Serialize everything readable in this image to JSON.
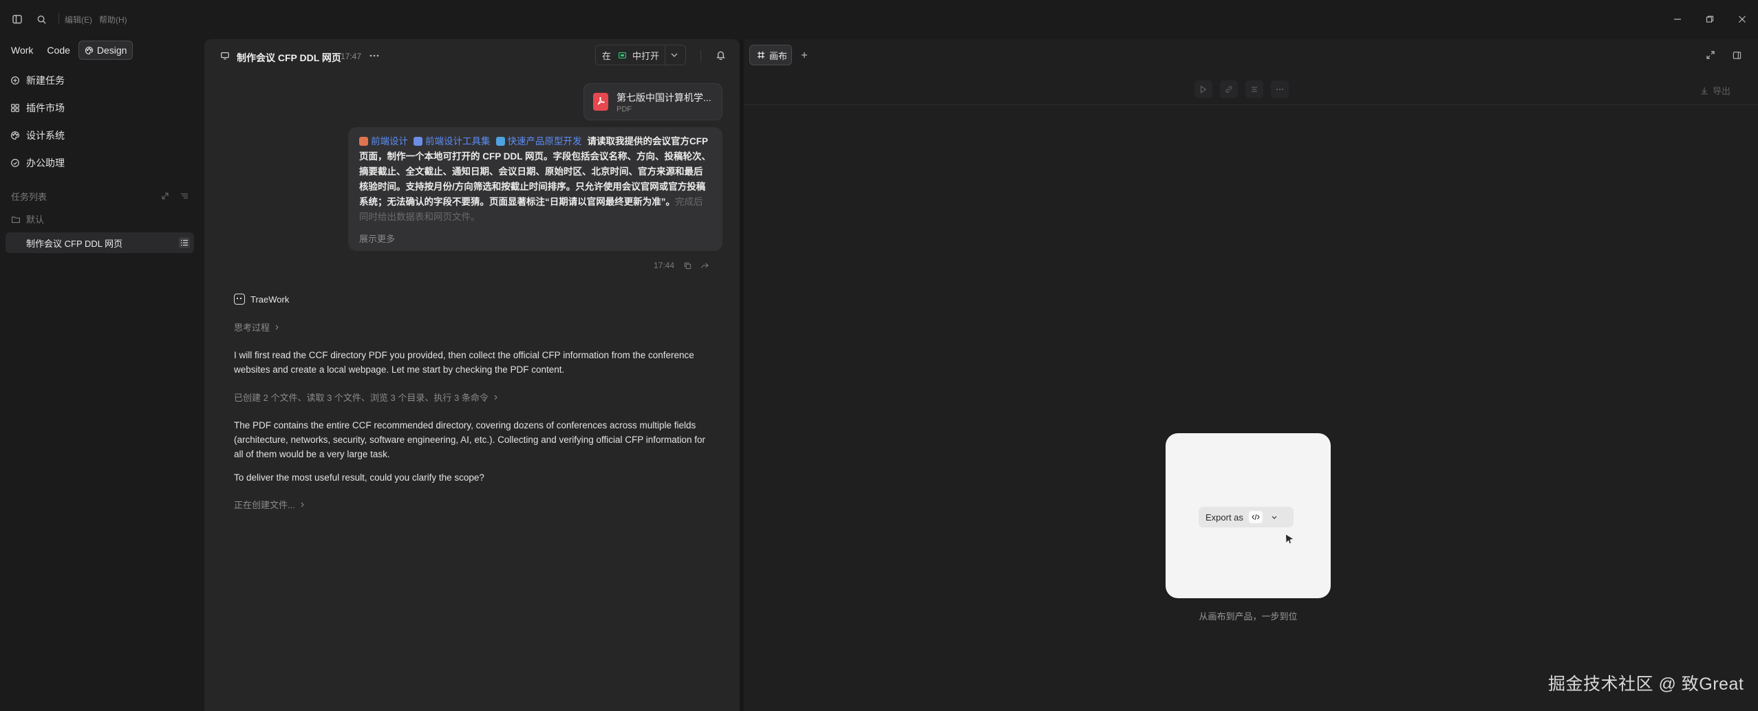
{
  "titlebar": {
    "menu_edit": "编辑(E)",
    "menu_help": "帮助(H)"
  },
  "modes": [
    {
      "label": "Work",
      "active": false
    },
    {
      "label": "Code",
      "active": false
    },
    {
      "label": "Design",
      "active": true
    }
  ],
  "sidebar": {
    "items": [
      {
        "label": "新建任务",
        "icon": "plus-circle-icon"
      },
      {
        "label": "插件市场",
        "icon": "plugin-grid-icon"
      },
      {
        "label": "设计系统",
        "icon": "palette-icon"
      },
      {
        "label": "办公助理",
        "icon": "briefcase-icon"
      }
    ],
    "task_list_label": "任务列表",
    "folder_label": "默认",
    "task_item_label": "制作会议 CFP DDL 网页"
  },
  "chat": {
    "title": "制作会议 CFP DDL 网页",
    "time": "17:47",
    "open_in_prefix": "在",
    "open_in_label": "中打开",
    "attachment": {
      "name": "第七版中国计算机学...",
      "type": "PDF"
    },
    "user_message": {
      "tags": [
        {
          "label": "前端设计",
          "color": "#e0744f"
        },
        {
          "label": "前端设计工具集",
          "color": "#6b8de6"
        },
        {
          "label": "快速产品原型开发",
          "color": "#4fa3e0"
        }
      ],
      "text": "请读取我提供的会议官方CFP 页面，制作一个本地可打开的 CFP DDL 网页。字段包括会议名称、方向、投稿轮次、摘要截止、全文截止、通知日期、会议日期、原始时区、北京时间、官方来源和最后核验时间。支持按月份/方向筛选和按截止时间排序。只允许使用会议官网或官方投稿系统；无法确认的字段不要猜。页面显著标注“日期请以官网最终更新为准”。",
      "fade_text": "完成后同时给出数据表和网页文件。",
      "show_more": "展示更多",
      "time": "17:44"
    },
    "agent_name": "TraeWork",
    "thinking_label": "思考过程",
    "para1": "I will first read the CCF directory PDF you provided, then collect the official CFP information from the conference websites and create a local webpage. Let me start by checking the PDF content.",
    "tool_summary": "已创建 2 个文件、读取 3 个文件、浏览 3 个目录、执行 3 条命令",
    "para2": "The PDF contains the entire CCF recommended directory, covering dozens of conferences across multiple fields (architecture, networks, security, software engineering, AI, etc.). Collecting and verifying official CFP information for all of them would be a very large task.",
    "para3": "To deliver the most useful result, could you clarify the scope?",
    "creating_label": "正在创建文件..."
  },
  "canvas": {
    "tab_label": "画布",
    "export_label": "导出",
    "export_as_label": "Export as",
    "caption": "从画布到产品，一步到位"
  },
  "watermark": "掘金技术社区 @ 致Great"
}
